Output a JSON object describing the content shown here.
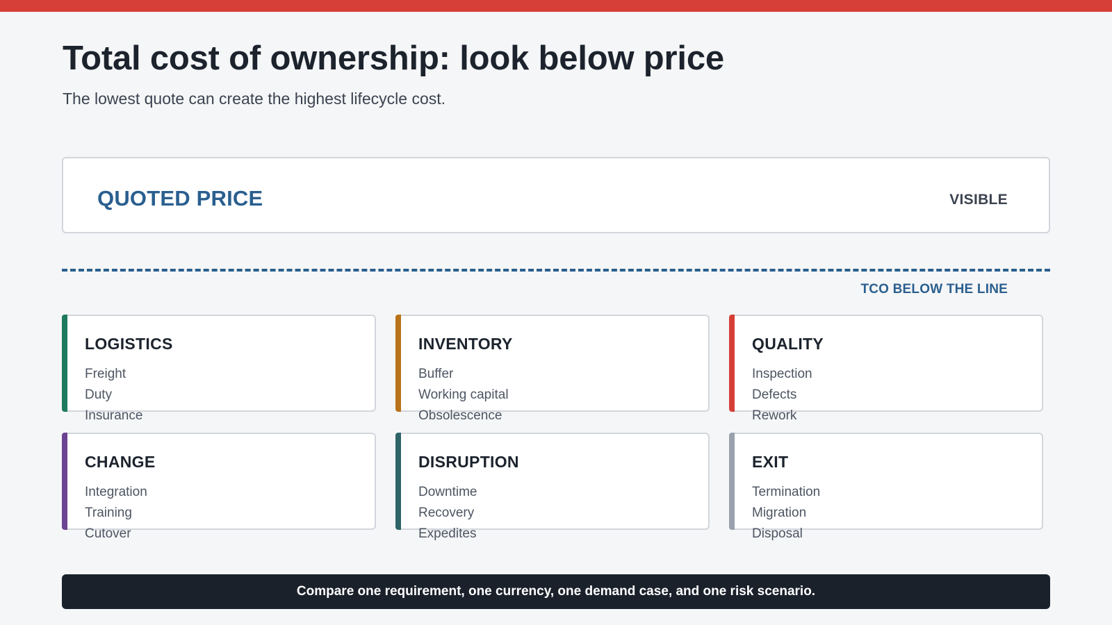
{
  "header": {
    "title": "Total cost of ownership: look below price",
    "subtitle": "The lowest quote can create the highest lifecycle cost."
  },
  "price_box": {
    "label": "QUOTED PRICE",
    "state": "VISIBLE"
  },
  "waterline": {
    "caption": "TCO BELOW THE LINE"
  },
  "cost_categories": [
    {
      "title": "LOGISTICS",
      "color": "#1e7a5e",
      "items": [
        "Freight",
        "Duty",
        "Insurance"
      ]
    },
    {
      "title": "INVENTORY",
      "color": "#b8731a",
      "items": [
        "Buffer",
        "Working capital",
        "Obsolescence"
      ]
    },
    {
      "title": "QUALITY",
      "color": "#d63f37",
      "items": [
        "Inspection",
        "Defects",
        "Rework"
      ]
    },
    {
      "title": "CHANGE",
      "color": "#6b4393",
      "items": [
        "Integration",
        "Training",
        "Cutover"
      ]
    },
    {
      "title": "DISRUPTION",
      "color": "#2f6468",
      "items": [
        "Downtime",
        "Recovery",
        "Expedites"
      ]
    },
    {
      "title": "EXIT",
      "color": "#99a1ac",
      "items": [
        "Termination",
        "Migration",
        "Disposal"
      ]
    }
  ],
  "footer": {
    "text": "Compare one requirement, one currency, one demand case, and one risk scenario."
  },
  "colors": {
    "accent_top": "#d63f37",
    "brand_blue": "#2a5f8f",
    "footer_bg": "#1a212b"
  }
}
